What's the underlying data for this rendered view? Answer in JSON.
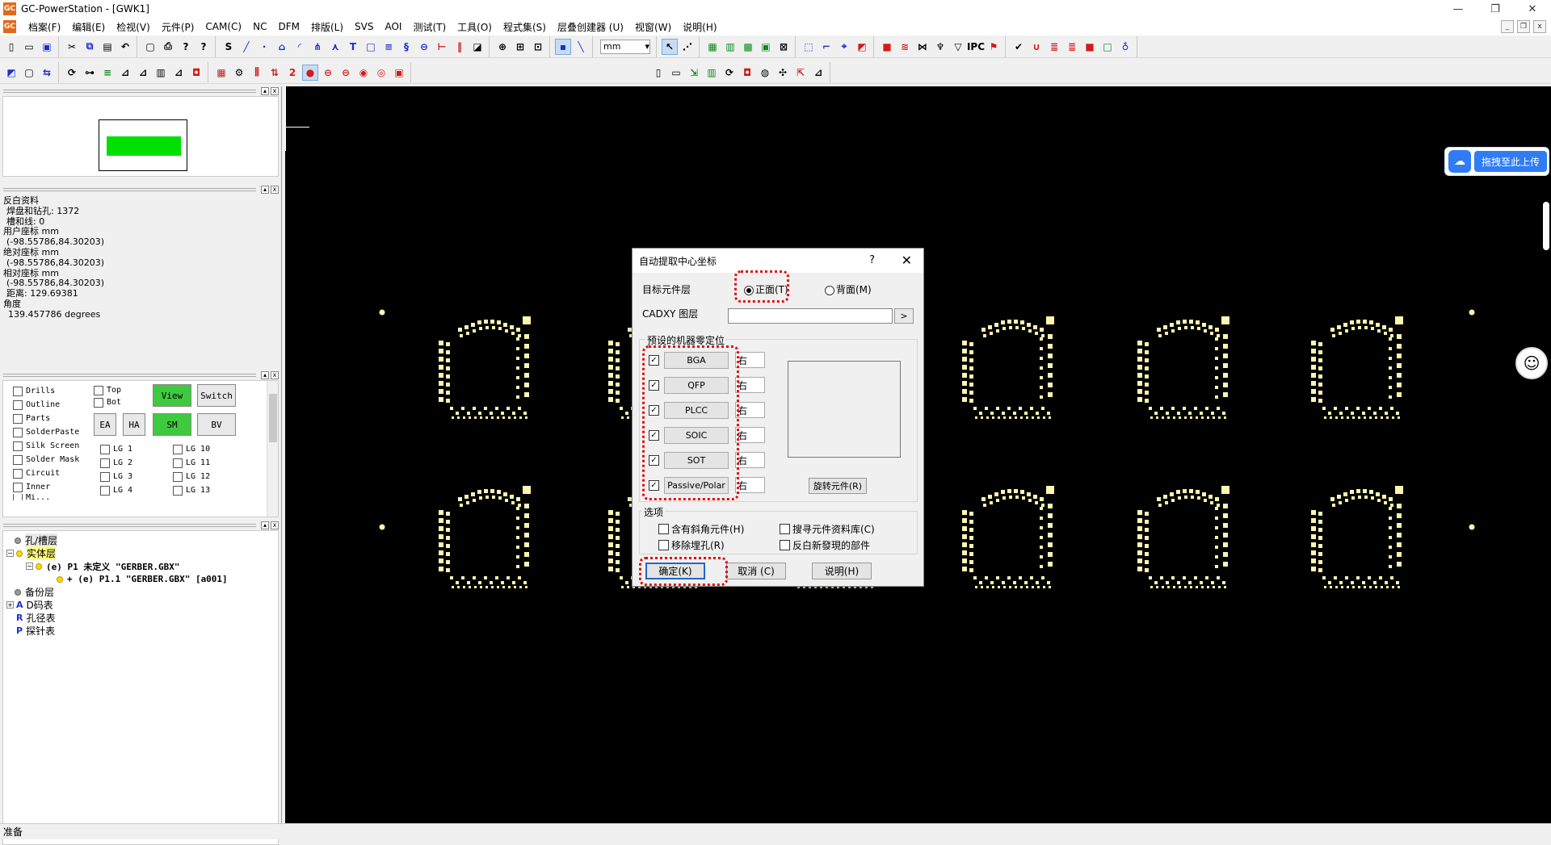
{
  "window": {
    "app_icon": "GC",
    "title": "GC-PowerStation - [GWK1]",
    "buttons": [
      "—",
      "❐",
      "✕"
    ]
  },
  "menubar": {
    "items": [
      "档案(F)",
      "编辑(E)",
      "检视(V)",
      "元件(P)",
      "CAM(C)",
      "NC",
      "DFM",
      "排版(L)",
      "SVS",
      "AOI",
      "测试(T)",
      "工具(O)",
      "程式集(S)",
      "层叠创建器 (U)",
      "视窗(W)",
      "说明(H)"
    ],
    "mdi_buttons": [
      "_",
      "❐",
      "x"
    ]
  },
  "toolbar": {
    "unit": "mm"
  },
  "left_panel": {
    "info": {
      "title": "反白资料",
      "pads_label": "焊盘和钻孔: 1372",
      "slots_label": "槽和线: 0",
      "user_coord_label": "用户座标 mm",
      "user_coord_value": "(-98.55786,84.30203)",
      "abs_coord_label": "绝对座标 mm",
      "abs_coord_value": "(-98.55786,84.30203)",
      "rel_coord_label": "相对座标 mm",
      "rel_coord_value": "(-98.55786,84.30203)",
      "distance_label": "距离: 129.69381",
      "angle_label": "角度",
      "angle_value": "139.457786 degrees"
    },
    "layers": {
      "col1": [
        "Drills",
        "Outline",
        "Parts",
        "SolderPaste",
        "Silk Screen",
        "Solder Mask",
        "Circuit",
        "Inner",
        "Mi..."
      ],
      "col2": [
        "Top",
        "Bot"
      ],
      "buttons": {
        "view": "View",
        "switch": "Switch",
        "ea": "EA",
        "ha": "HA",
        "sm": "SM",
        "bv": "BV"
      },
      "lg_left": [
        "LG 1",
        "LG 2",
        "LG 3",
        "LG 4"
      ],
      "lg_right": [
        "LG 10",
        "LG 11",
        "LG 12",
        "LG 13"
      ]
    },
    "tree": {
      "holes": "孔/槽层",
      "solid": "实体层",
      "p1": "(e) P1 未定义 \"GERBER.GBX\"",
      "p11": "+ (e) P1.1 \"GERBER.GBX\" [a001]",
      "backup": "备份层",
      "dcode": "D码表",
      "holes_table": "孔径表",
      "probe_table": "探针表"
    }
  },
  "side_widgets": {
    "upload_label": "拖拽至此上传"
  },
  "dialog": {
    "title": "自动提取中心坐标",
    "help": "?",
    "close": "✕",
    "target_layer_label": "目标元件层",
    "front_label": "正面(T)",
    "back_label": "背面(M)",
    "front_selected": true,
    "cadxy_label": "CADXY 图层",
    "cadxy_btn": ">",
    "machine_group_label": "预设的机器零定位",
    "machines": [
      {
        "name": "BGA",
        "side": "右",
        "checked": true
      },
      {
        "name": "QFP",
        "side": "右",
        "checked": true
      },
      {
        "name": "PLCC",
        "side": "右",
        "checked": true
      },
      {
        "name": "SOIC",
        "side": "右",
        "checked": true
      },
      {
        "name": "SOT",
        "side": "右",
        "checked": true
      },
      {
        "name": "Passive/Polar",
        "side": "右",
        "checked": true
      }
    ],
    "rotate_btn": "旋转元件(R)",
    "options_label": "选项",
    "opt_bevel": "含有斜角元件(H)",
    "opt_search_lib": "搜寻元件资料库(C)",
    "opt_remove_vias": "移除埋孔(R)",
    "opt_highlight_new": "反白新發現的部件",
    "ok": "确定(K)",
    "cancel": "取消 (C)",
    "help_btn": "说明(H)"
  },
  "statusbar": {
    "text": "准备"
  },
  "colors": {
    "canvas_bg": "#000000",
    "pad": "#fff5b0",
    "overview_green": "#00e000",
    "highlight_red": "#e01010",
    "upload_blue": "#2f7cf6"
  }
}
